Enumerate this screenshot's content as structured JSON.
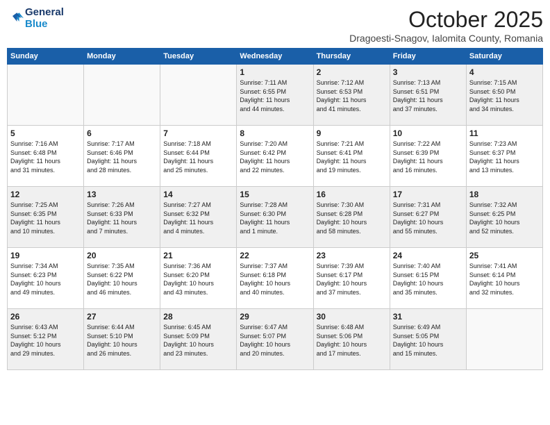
{
  "header": {
    "logo_line1": "General",
    "logo_line2": "Blue",
    "month_title": "October 2025",
    "subtitle": "Dragoesti-Snagov, Ialomita County, Romania"
  },
  "weekdays": [
    "Sunday",
    "Monday",
    "Tuesday",
    "Wednesday",
    "Thursday",
    "Friday",
    "Saturday"
  ],
  "weeks": [
    [
      {
        "day": "",
        "info": ""
      },
      {
        "day": "",
        "info": ""
      },
      {
        "day": "",
        "info": ""
      },
      {
        "day": "1",
        "info": "Sunrise: 7:11 AM\nSunset: 6:55 PM\nDaylight: 11 hours\nand 44 minutes."
      },
      {
        "day": "2",
        "info": "Sunrise: 7:12 AM\nSunset: 6:53 PM\nDaylight: 11 hours\nand 41 minutes."
      },
      {
        "day": "3",
        "info": "Sunrise: 7:13 AM\nSunset: 6:51 PM\nDaylight: 11 hours\nand 37 minutes."
      },
      {
        "day": "4",
        "info": "Sunrise: 7:15 AM\nSunset: 6:50 PM\nDaylight: 11 hours\nand 34 minutes."
      }
    ],
    [
      {
        "day": "5",
        "info": "Sunrise: 7:16 AM\nSunset: 6:48 PM\nDaylight: 11 hours\nand 31 minutes."
      },
      {
        "day": "6",
        "info": "Sunrise: 7:17 AM\nSunset: 6:46 PM\nDaylight: 11 hours\nand 28 minutes."
      },
      {
        "day": "7",
        "info": "Sunrise: 7:18 AM\nSunset: 6:44 PM\nDaylight: 11 hours\nand 25 minutes."
      },
      {
        "day": "8",
        "info": "Sunrise: 7:20 AM\nSunset: 6:42 PM\nDaylight: 11 hours\nand 22 minutes."
      },
      {
        "day": "9",
        "info": "Sunrise: 7:21 AM\nSunset: 6:41 PM\nDaylight: 11 hours\nand 19 minutes."
      },
      {
        "day": "10",
        "info": "Sunrise: 7:22 AM\nSunset: 6:39 PM\nDaylight: 11 hours\nand 16 minutes."
      },
      {
        "day": "11",
        "info": "Sunrise: 7:23 AM\nSunset: 6:37 PM\nDaylight: 11 hours\nand 13 minutes."
      }
    ],
    [
      {
        "day": "12",
        "info": "Sunrise: 7:25 AM\nSunset: 6:35 PM\nDaylight: 11 hours\nand 10 minutes."
      },
      {
        "day": "13",
        "info": "Sunrise: 7:26 AM\nSunset: 6:33 PM\nDaylight: 11 hours\nand 7 minutes."
      },
      {
        "day": "14",
        "info": "Sunrise: 7:27 AM\nSunset: 6:32 PM\nDaylight: 11 hours\nand 4 minutes."
      },
      {
        "day": "15",
        "info": "Sunrise: 7:28 AM\nSunset: 6:30 PM\nDaylight: 11 hours\nand 1 minute."
      },
      {
        "day": "16",
        "info": "Sunrise: 7:30 AM\nSunset: 6:28 PM\nDaylight: 10 hours\nand 58 minutes."
      },
      {
        "day": "17",
        "info": "Sunrise: 7:31 AM\nSunset: 6:27 PM\nDaylight: 10 hours\nand 55 minutes."
      },
      {
        "day": "18",
        "info": "Sunrise: 7:32 AM\nSunset: 6:25 PM\nDaylight: 10 hours\nand 52 minutes."
      }
    ],
    [
      {
        "day": "19",
        "info": "Sunrise: 7:34 AM\nSunset: 6:23 PM\nDaylight: 10 hours\nand 49 minutes."
      },
      {
        "day": "20",
        "info": "Sunrise: 7:35 AM\nSunset: 6:22 PM\nDaylight: 10 hours\nand 46 minutes."
      },
      {
        "day": "21",
        "info": "Sunrise: 7:36 AM\nSunset: 6:20 PM\nDaylight: 10 hours\nand 43 minutes."
      },
      {
        "day": "22",
        "info": "Sunrise: 7:37 AM\nSunset: 6:18 PM\nDaylight: 10 hours\nand 40 minutes."
      },
      {
        "day": "23",
        "info": "Sunrise: 7:39 AM\nSunset: 6:17 PM\nDaylight: 10 hours\nand 37 minutes."
      },
      {
        "day": "24",
        "info": "Sunrise: 7:40 AM\nSunset: 6:15 PM\nDaylight: 10 hours\nand 35 minutes."
      },
      {
        "day": "25",
        "info": "Sunrise: 7:41 AM\nSunset: 6:14 PM\nDaylight: 10 hours\nand 32 minutes."
      }
    ],
    [
      {
        "day": "26",
        "info": "Sunrise: 6:43 AM\nSunset: 5:12 PM\nDaylight: 10 hours\nand 29 minutes."
      },
      {
        "day": "27",
        "info": "Sunrise: 6:44 AM\nSunset: 5:10 PM\nDaylight: 10 hours\nand 26 minutes."
      },
      {
        "day": "28",
        "info": "Sunrise: 6:45 AM\nSunset: 5:09 PM\nDaylight: 10 hours\nand 23 minutes."
      },
      {
        "day": "29",
        "info": "Sunrise: 6:47 AM\nSunset: 5:07 PM\nDaylight: 10 hours\nand 20 minutes."
      },
      {
        "day": "30",
        "info": "Sunrise: 6:48 AM\nSunset: 5:06 PM\nDaylight: 10 hours\nand 17 minutes."
      },
      {
        "day": "31",
        "info": "Sunrise: 6:49 AM\nSunset: 5:05 PM\nDaylight: 10 hours\nand 15 minutes."
      },
      {
        "day": "",
        "info": ""
      }
    ]
  ]
}
